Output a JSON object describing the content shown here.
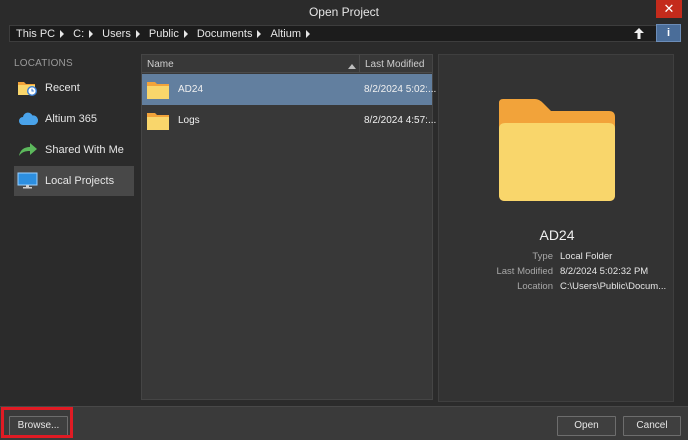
{
  "window": {
    "title": "Open Project",
    "close_glyph": "✕"
  },
  "address": {
    "crumbs": [
      "This PC",
      "C:",
      "Users",
      "Public",
      "Documents",
      "Altium"
    ],
    "up_icon": "arrow-up-icon",
    "info_glyph": "i"
  },
  "sidebar": {
    "heading": "LOCATIONS",
    "items": [
      {
        "label": "Recent",
        "icon": "recent-folder-icon",
        "selected": false
      },
      {
        "label": "Altium 365",
        "icon": "cloud-icon",
        "selected": false
      },
      {
        "label": "Shared With Me",
        "icon": "share-arrow-icon",
        "selected": false
      },
      {
        "label": "Local Projects",
        "icon": "monitor-icon",
        "selected": true
      }
    ]
  },
  "filelist": {
    "columns": {
      "name": "Name",
      "modified": "Last Modified"
    },
    "sort": "ascending",
    "rows": [
      {
        "name": "AD24",
        "modified": "8/2/2024 5:02:...",
        "selected": true
      },
      {
        "name": "Logs",
        "modified": "8/2/2024 4:57:...",
        "selected": false
      }
    ]
  },
  "preview": {
    "name": "AD24",
    "type_label": "Type",
    "type_value": "Local Folder",
    "modified_label": "Last Modified",
    "modified_value": "8/2/2024 5:02:32 PM",
    "location_label": "Location",
    "location_value": "C:\\Users\\Public\\Docum..."
  },
  "footer": {
    "browse_label": "Browse...",
    "open_label": "Open",
    "cancel_label": "Cancel"
  },
  "colors": {
    "accent": "#4a6d99",
    "selection": "#627f9f",
    "folder_front": "#f9d66b",
    "folder_back": "#f2a33a",
    "highlight": "#e01b24"
  }
}
